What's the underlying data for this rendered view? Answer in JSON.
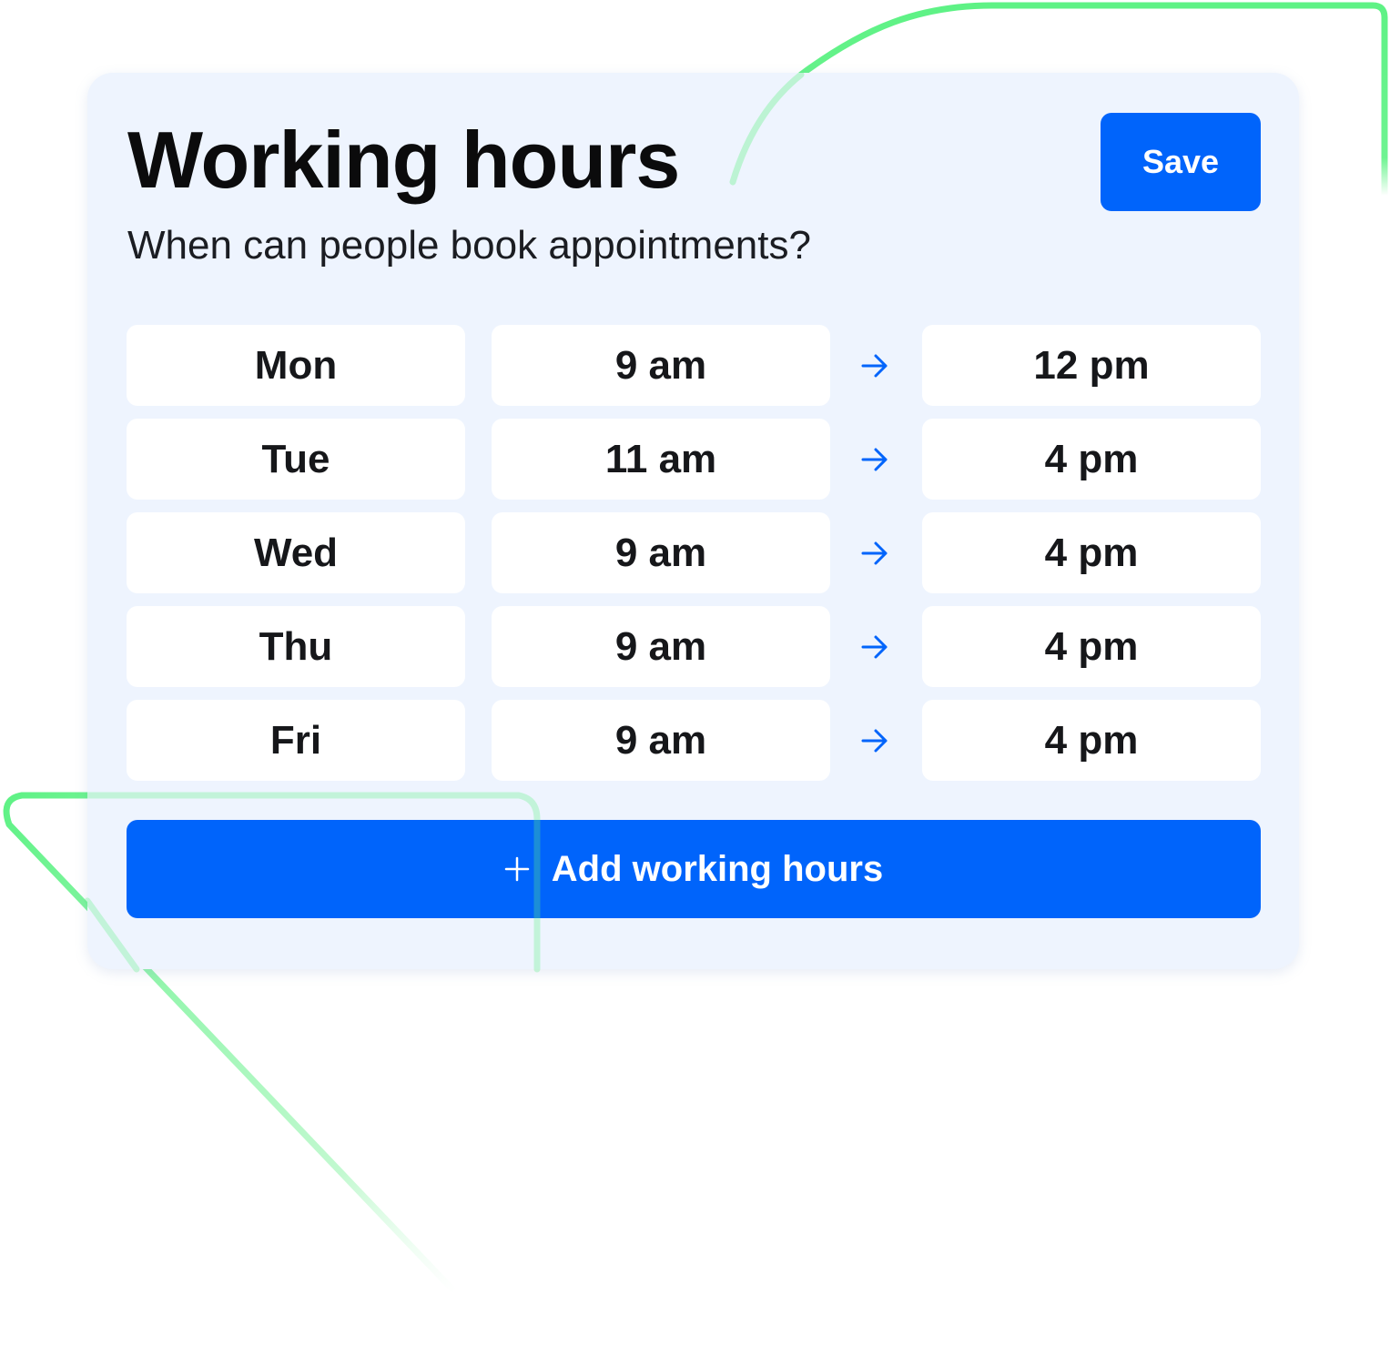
{
  "card": {
    "title": "Working hours",
    "subtitle": "When can people book appointments?",
    "save_label": "Save"
  },
  "schedule": [
    {
      "day": "Mon",
      "start": "9 am",
      "end": "12 pm"
    },
    {
      "day": "Tue",
      "start": "11 am",
      "end": "4 pm"
    },
    {
      "day": "Wed",
      "start": "9 am",
      "end": "4 pm"
    },
    {
      "day": "Thu",
      "start": "9 am",
      "end": "4 pm"
    },
    {
      "day": "Fri",
      "start": "9 am",
      "end": "4 pm"
    }
  ],
  "add_button": {
    "label": "Add working hours",
    "icon": "plus-icon"
  },
  "colors": {
    "accent": "#0064fb",
    "card_background": "#eef4fe",
    "cell_background": "#ffffff",
    "decor_line": "#5ef285"
  }
}
